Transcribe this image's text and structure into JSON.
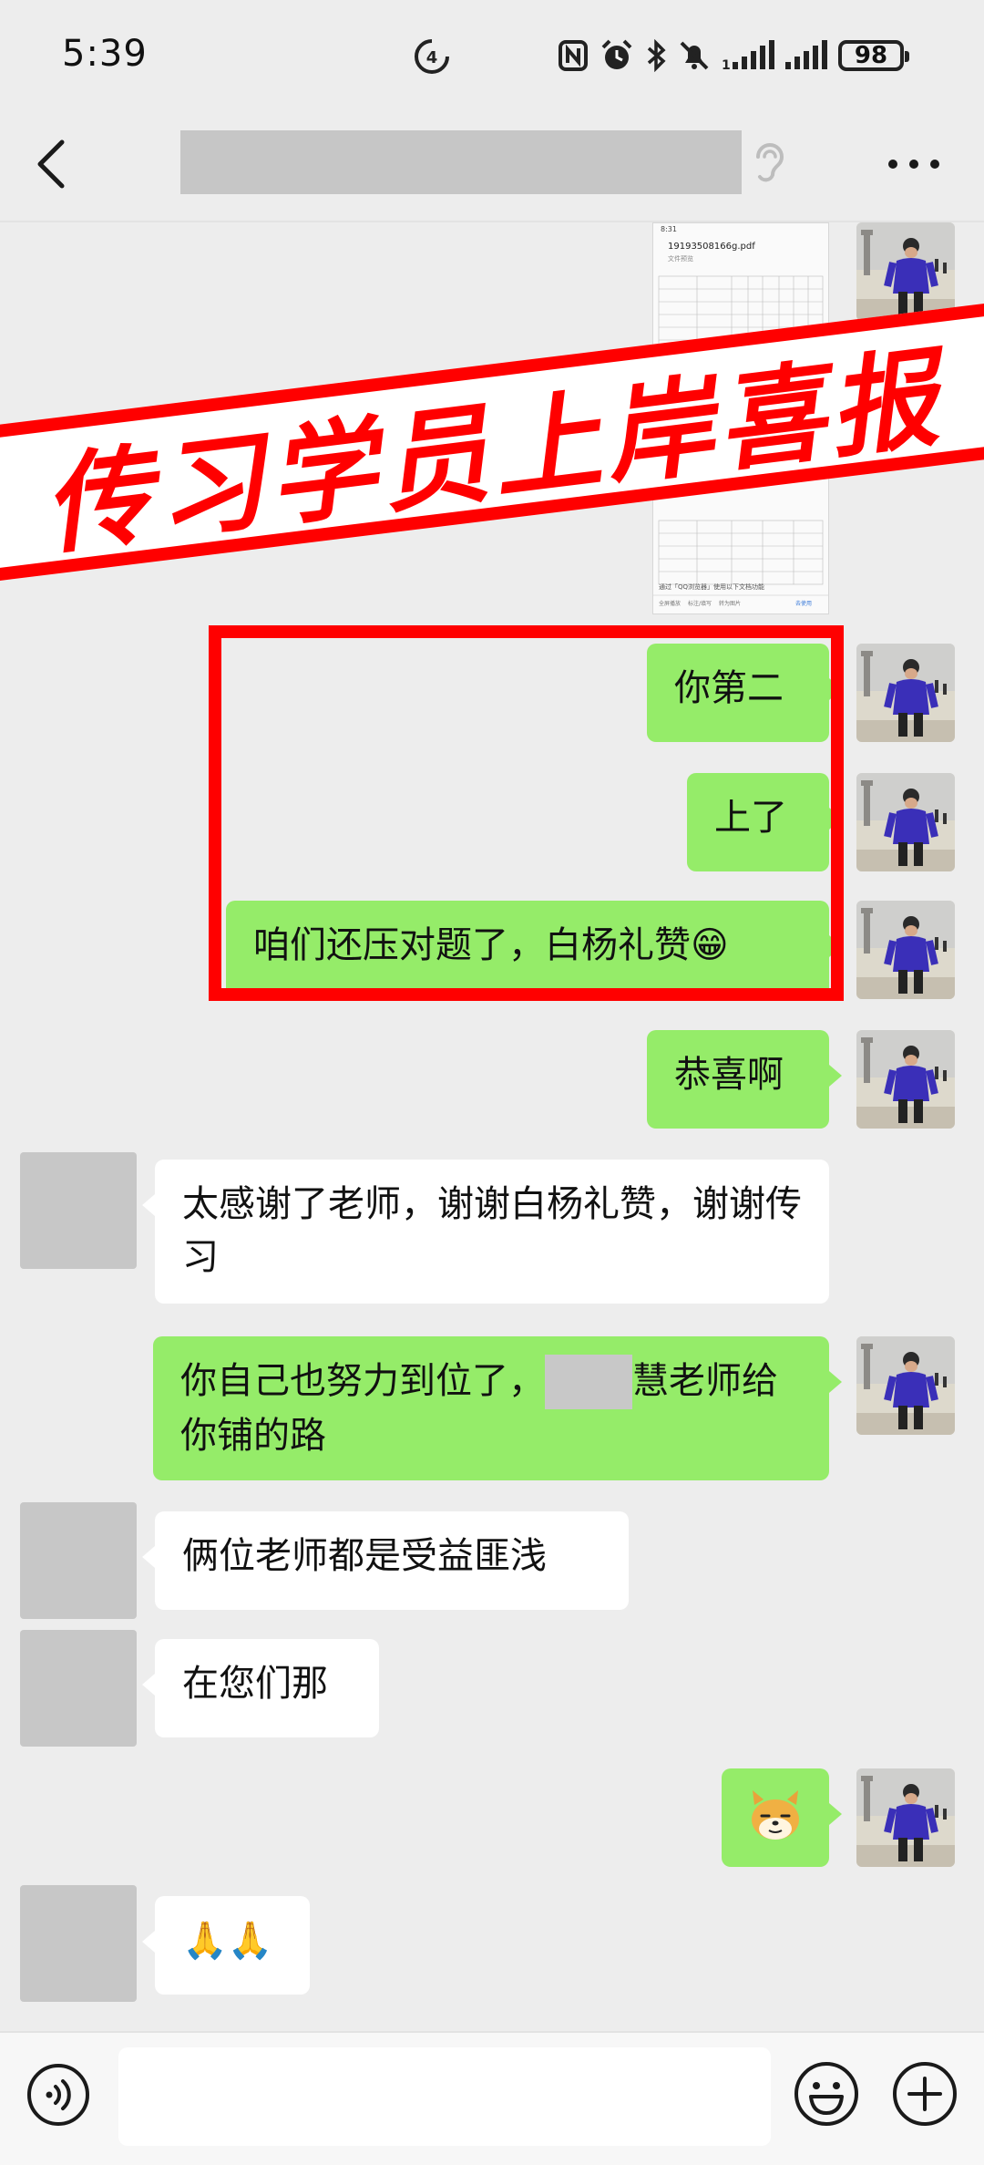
{
  "status": {
    "time": "5:39",
    "battery": "98"
  },
  "chat": {
    "title_hidden": true,
    "promo_banner": "传习学员上岸喜报",
    "pdf_file": {
      "time": "8:31",
      "name": "19193508166g.pdf",
      "subtitle": "文件预览",
      "footer": "通过「QQ浏览器」使用以下文档功能",
      "actions": [
        "全屏播放",
        "标注/填写",
        "转为图片"
      ],
      "other_action": "去使用"
    },
    "messages": [
      {
        "from": "me",
        "text": "你第二"
      },
      {
        "from": "me",
        "text": "上了"
      },
      {
        "from": "me",
        "text": "咱们还压对题了，白杨礼赞😁"
      },
      {
        "from": "me",
        "text": "恭喜啊"
      },
      {
        "from": "other",
        "text": "太感谢了老师，谢谢白杨礼赞，谢谢传习"
      },
      {
        "from": "me",
        "text_before": "你自己也努力到位了，",
        "text_after": "慧老师给你铺的路"
      },
      {
        "from": "other",
        "text": "俩位老师都是受益匪浅"
      },
      {
        "from": "other",
        "text": "在您们那"
      },
      {
        "from": "me",
        "sticker": "shiba-doge-emoji"
      },
      {
        "from": "other",
        "text": "🙏🙏"
      }
    ]
  },
  "input": {
    "placeholder": ""
  },
  "colors": {
    "my_bubble": "#95ec69",
    "other_bubble": "#ffffff",
    "background": "#ededed",
    "highlight": "#ff0000"
  }
}
